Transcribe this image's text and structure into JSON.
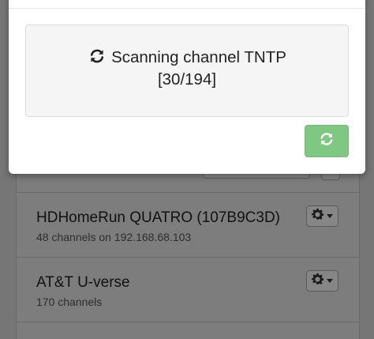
{
  "modal": {
    "status_line1": "Scanning channel TNTP",
    "status_line2": "[30/194]",
    "colors": {
      "rescan_button": "#7fc882",
      "status_box": "#f5f5f5"
    },
    "icons": {
      "status": "refresh-icon",
      "button": "refresh-icon"
    }
  },
  "devices": [
    {
      "name": "HDHomeRun QUATRO (107B9C3D)",
      "detail": "48 channels on 192.168.68.103",
      "menu_icon": "gear-icon"
    },
    {
      "name": "AT&T U-verse",
      "detail": "170 channels",
      "menu_icon": "gear-icon"
    }
  ]
}
